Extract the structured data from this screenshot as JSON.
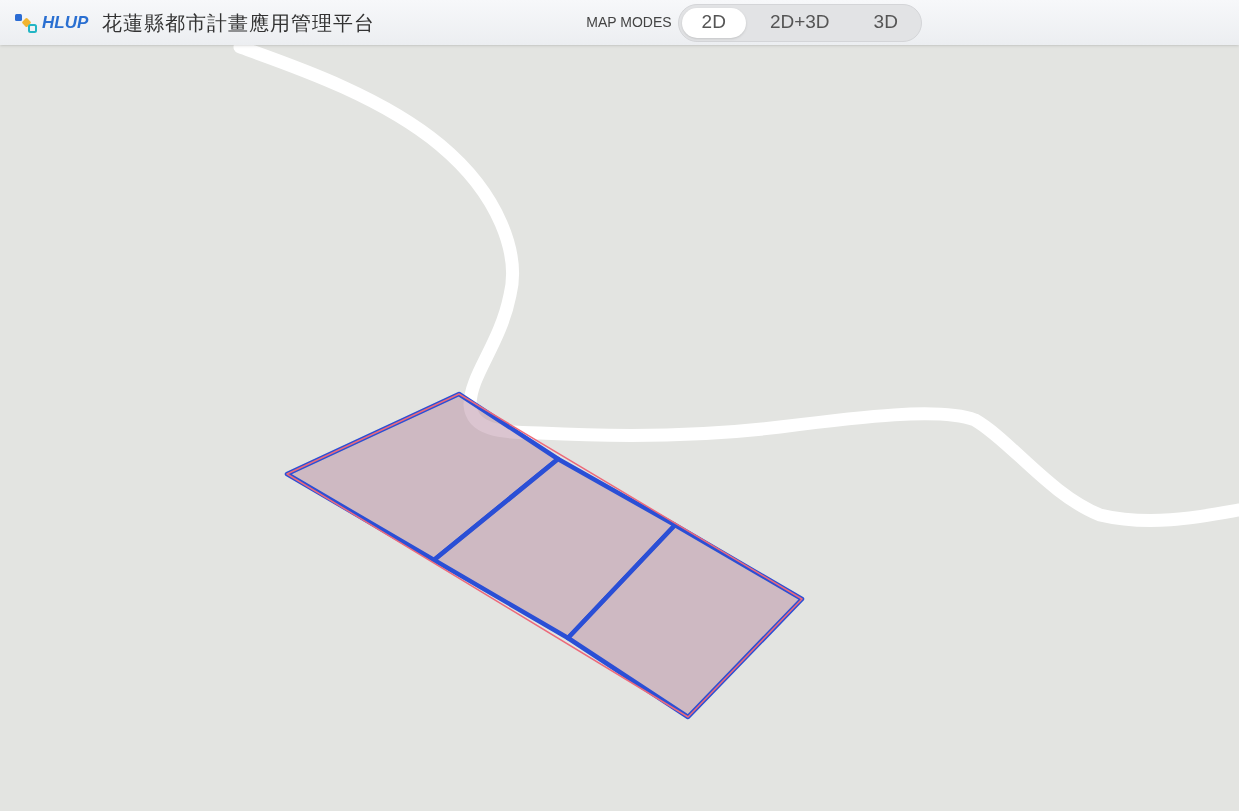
{
  "header": {
    "logo_text": "HLUP",
    "title": "花蓮縣都市計畫應用管理平台"
  },
  "map_modes": {
    "label": "MAP MODES",
    "options": [
      {
        "label": "2D",
        "selected": true
      },
      {
        "label": "2D+3D",
        "selected": false
      },
      {
        "label": "3D",
        "selected": false
      }
    ]
  }
}
